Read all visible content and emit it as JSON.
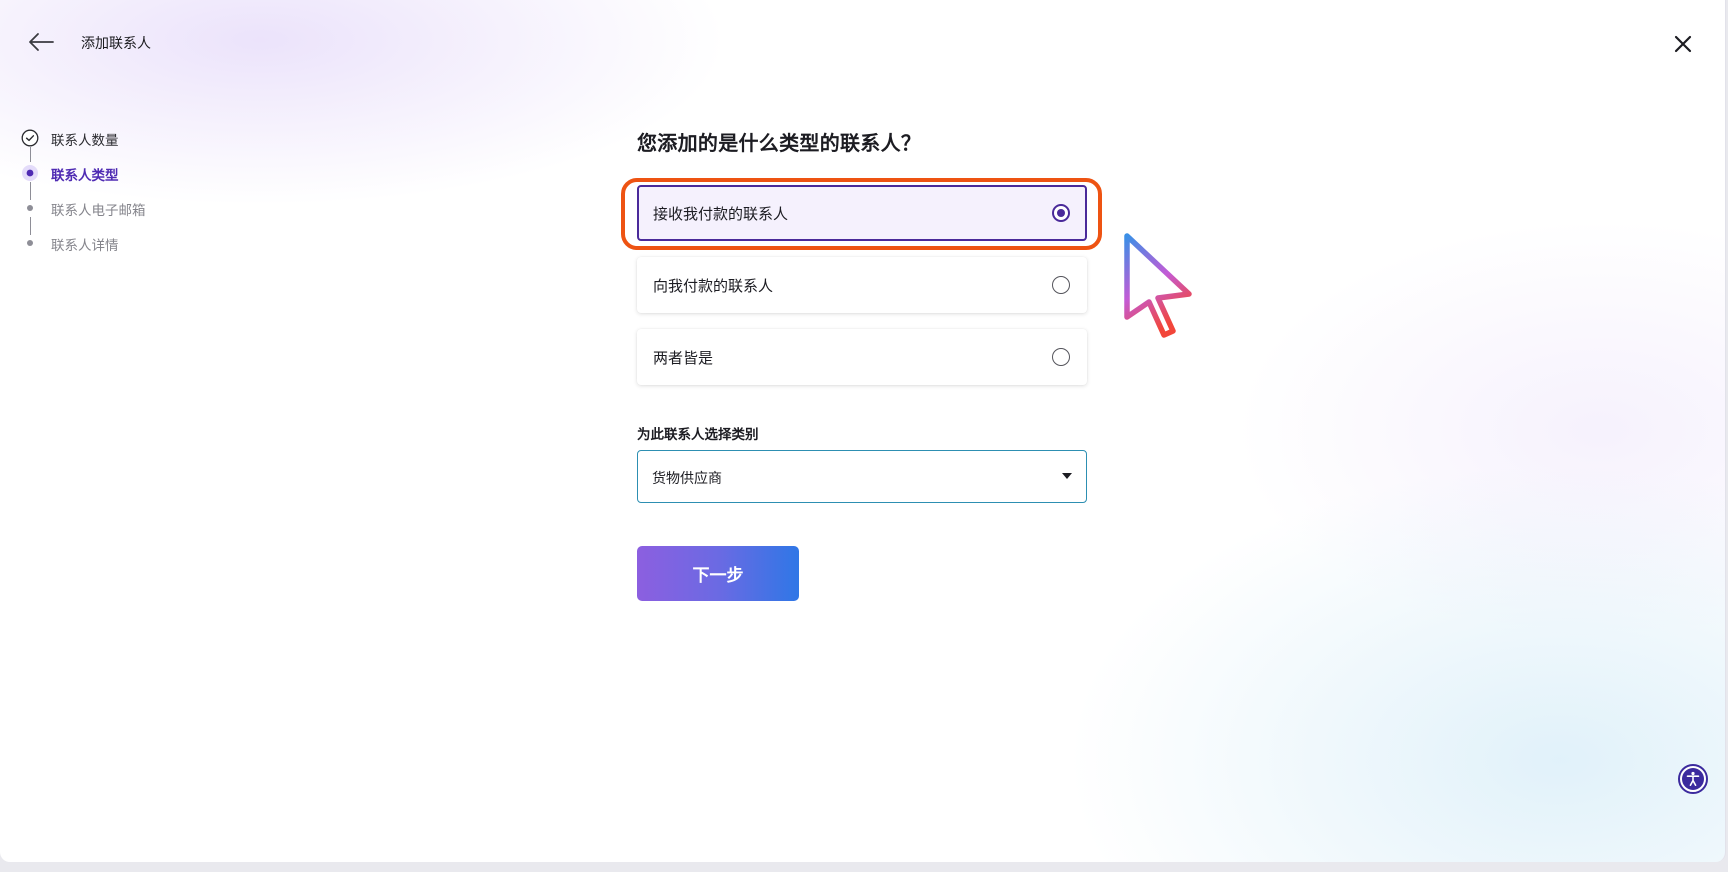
{
  "header": {
    "title": "添加联系人",
    "back_icon": "arrow-left-icon",
    "close_icon": "close-icon"
  },
  "stepper": {
    "steps": [
      {
        "label": "联系人数量",
        "state": "completed"
      },
      {
        "label": "联系人类型",
        "state": "active"
      },
      {
        "label": "联系人电子邮箱",
        "state": "pending"
      },
      {
        "label": "联系人详情",
        "state": "pending"
      }
    ]
  },
  "main": {
    "question": "您添加的是什么类型的联系人？",
    "options": [
      {
        "label": "接收我付款的联系人",
        "selected": true
      },
      {
        "label": "向我付款的联系人",
        "selected": false
      },
      {
        "label": "两者皆是",
        "selected": false
      }
    ],
    "category": {
      "label": "为此联系人选择类别",
      "value": "货物供应商"
    },
    "next_button": "下一步"
  },
  "colors": {
    "accent": "#4a2a9a",
    "highlight": "#ee5312",
    "select_border": "#2d8fb2"
  },
  "accessibility_icon": "accessibility-icon"
}
